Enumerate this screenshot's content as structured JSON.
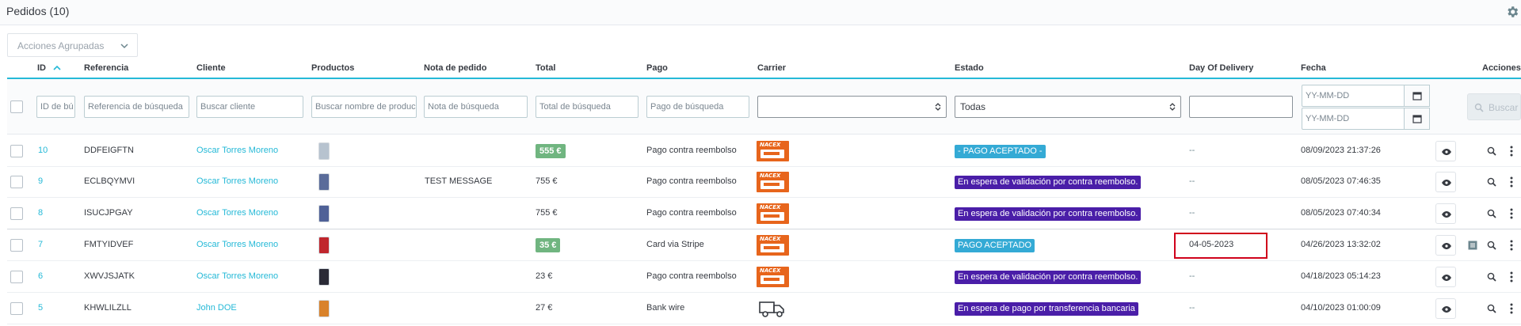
{
  "panel": {
    "title": "Pedidos (10)"
  },
  "bulk_actions": {
    "label": "Acciones Agrupadas"
  },
  "columns": {
    "id": "ID",
    "reference": "Referencia",
    "customer": "Cliente",
    "products": "Productos",
    "order_note": "Nota de pedido",
    "total": "Total",
    "payment": "Pago",
    "carrier": "Carrier",
    "status": "Estado",
    "day_of_delivery": "Day Of Delivery",
    "date": "Fecha",
    "actions": "Acciones"
  },
  "filters": {
    "id_placeholder": "ID de bú",
    "reference_placeholder": "Referencia de búsqueda",
    "customer_placeholder": "Buscar cliente",
    "products_placeholder": "Buscar nombre de produc",
    "note_placeholder": "Nota de búsqueda",
    "total_placeholder": "Total de búsqueda",
    "payment_placeholder": "Pago de búsqueda",
    "carrier_value": "",
    "status_value": "Todas",
    "delivery_value": "",
    "date_from_placeholder": "YY-MM-DD",
    "date_to_placeholder": "YY-MM-DD",
    "search_label": "Buscar"
  },
  "orders": [
    {
      "id": "10",
      "reference": "DDFEIGFTN",
      "customer": "Oscar Torres Moreno",
      "note": "",
      "total": "555 €",
      "total_badge": true,
      "payment": "Pago contra reembolso",
      "carrier_label": "NACEX",
      "status": "- PAGO ACEPTADO -",
      "status_color": "#34aad5",
      "delivery": "--",
      "date": "08/09/2023 21:37:26",
      "thumb_color": "#b7c3cf",
      "has_invoice": false
    },
    {
      "id": "9",
      "reference": "ECLBQYMVI",
      "customer": "Oscar Torres Moreno",
      "note": "TEST MESSAGE",
      "total": "755 €",
      "total_badge": false,
      "payment": "Pago contra reembolso",
      "carrier_label": "NACEX",
      "status": "En espera de validación por contra reembolso.",
      "status_color": "#4a1ea8",
      "delivery": "--",
      "date": "08/05/2023 07:46:35",
      "thumb_color": "#5a6c9a",
      "has_invoice": false
    },
    {
      "id": "8",
      "reference": "ISUCJPGAY",
      "customer": "Oscar Torres Moreno",
      "note": "",
      "total": "755 €",
      "total_badge": false,
      "payment": "Pago contra reembolso",
      "carrier_label": "NACEX",
      "status": "En espera de validación por contra reembolso.",
      "status_color": "#4a1ea8",
      "delivery": "--",
      "date": "08/05/2023 07:40:34",
      "thumb_color": "#4f6197",
      "has_invoice": false
    },
    {
      "id": "7",
      "reference": "FMTYIDVEF",
      "customer": "Oscar Torres Moreno",
      "note": "",
      "total": "35 €",
      "total_badge": true,
      "payment": "Card via Stripe",
      "carrier_label": "NACEX",
      "status": "PAGO ACEPTADO",
      "status_color": "#34aad5",
      "delivery": "04-05-2023",
      "date": "04/26/2023 13:32:02",
      "thumb_color": "#c0262d",
      "has_invoice": true
    },
    {
      "id": "6",
      "reference": "XWVJSJATK",
      "customer": "Oscar Torres Moreno",
      "note": "",
      "total": "23 €",
      "total_badge": false,
      "payment": "Pago contra reembolso",
      "carrier_label": "NACEX",
      "status": "En espera de validación por contra reembolso.",
      "status_color": "#4a1ea8",
      "delivery": "--",
      "date": "04/18/2023 05:14:23",
      "thumb_color": "#2a2a36",
      "has_invoice": false
    },
    {
      "id": "5",
      "reference": "KHWLILZLL",
      "customer": "John DOE",
      "note": "",
      "total": "27 €",
      "total_badge": false,
      "payment": "Bank wire",
      "carrier_label": "",
      "status": "En espera de pago por transferencia bancaria",
      "status_color": "#4a1ea8",
      "delivery": "--",
      "date": "04/10/2023 01:00:09",
      "thumb_color": "#d9822b",
      "has_invoice": false
    }
  ]
}
